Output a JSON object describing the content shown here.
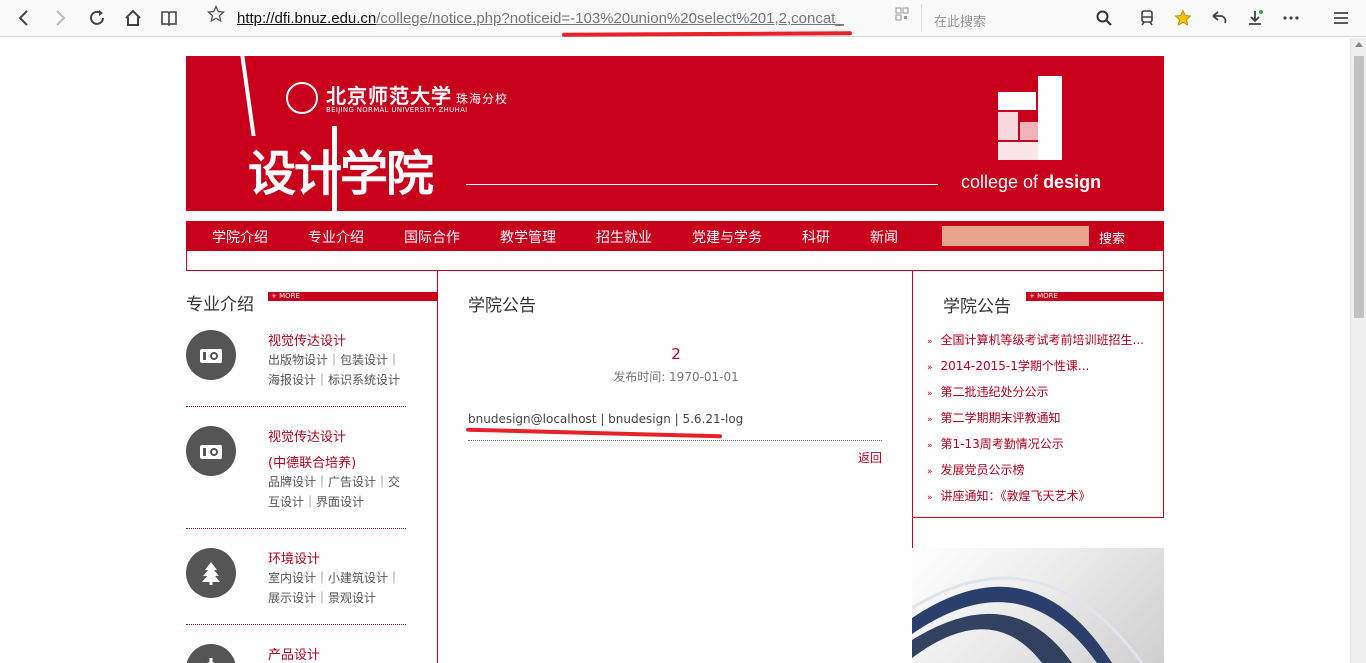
{
  "browser": {
    "url_host": "http://dfi.bnuz.edu.cn",
    "url_path": "/college/notice.php?noticeid=-103%20union%20select%201,2,concat_",
    "search_placeholder": "在此搜索"
  },
  "header": {
    "university_cn": "北京师范大学",
    "campus_cn": "珠海分校",
    "university_en": "BEIJING NORMAL UNIVERSITY ZHUHAI",
    "college_cn": "设计学院",
    "college_en_prefix": "college of ",
    "college_en_bold": "design"
  },
  "nav": {
    "items": [
      "学院介绍",
      "专业介绍",
      "国际合作",
      "教学管理",
      "招生就业",
      "党建与学务",
      "科研",
      "新闻"
    ],
    "search_label": "搜索"
  },
  "left": {
    "title": "专业介绍",
    "more": "+ MORE",
    "majors": [
      {
        "name": "视觉传达设计",
        "name2": "",
        "sub": "出版物设计｜包装设计｜海报设计｜标识系统设计",
        "icon": "camera-icon"
      },
      {
        "name": "视觉传达设计",
        "name2": "(中德联合培养)",
        "sub": "品牌设计｜广告设计｜交互设计｜界面设计",
        "icon": "camera-icon"
      },
      {
        "name": "环境设计",
        "name2": "",
        "sub": "室内设计｜小建筑设计｜展示设计｜景观设计",
        "icon": "tree-icon"
      },
      {
        "name": "产品设计",
        "name2": "",
        "sub": "",
        "icon": "gear-icon"
      }
    ]
  },
  "middle": {
    "title": "学院公告",
    "notice_title": "2",
    "notice_date": "发布时间: 1970-01-01",
    "notice_body": "bnudesign@localhost | bnudesign | 5.6.21-log",
    "back": "返回"
  },
  "right": {
    "title": "学院公告",
    "more": "+ MORE",
    "news": [
      "全国计算机等级考试考前培训班招生...",
      "2014-2015-1学期个性课...",
      "第二批违纪处分公示",
      "第二学期期末评教通知",
      "第1-13周考勤情况公示",
      "发展党员公示榜",
      "讲座通知：《敦煌飞天艺术》"
    ]
  },
  "colors": {
    "brand_red": "#c9001c",
    "annotation_red": "#e8202a"
  }
}
